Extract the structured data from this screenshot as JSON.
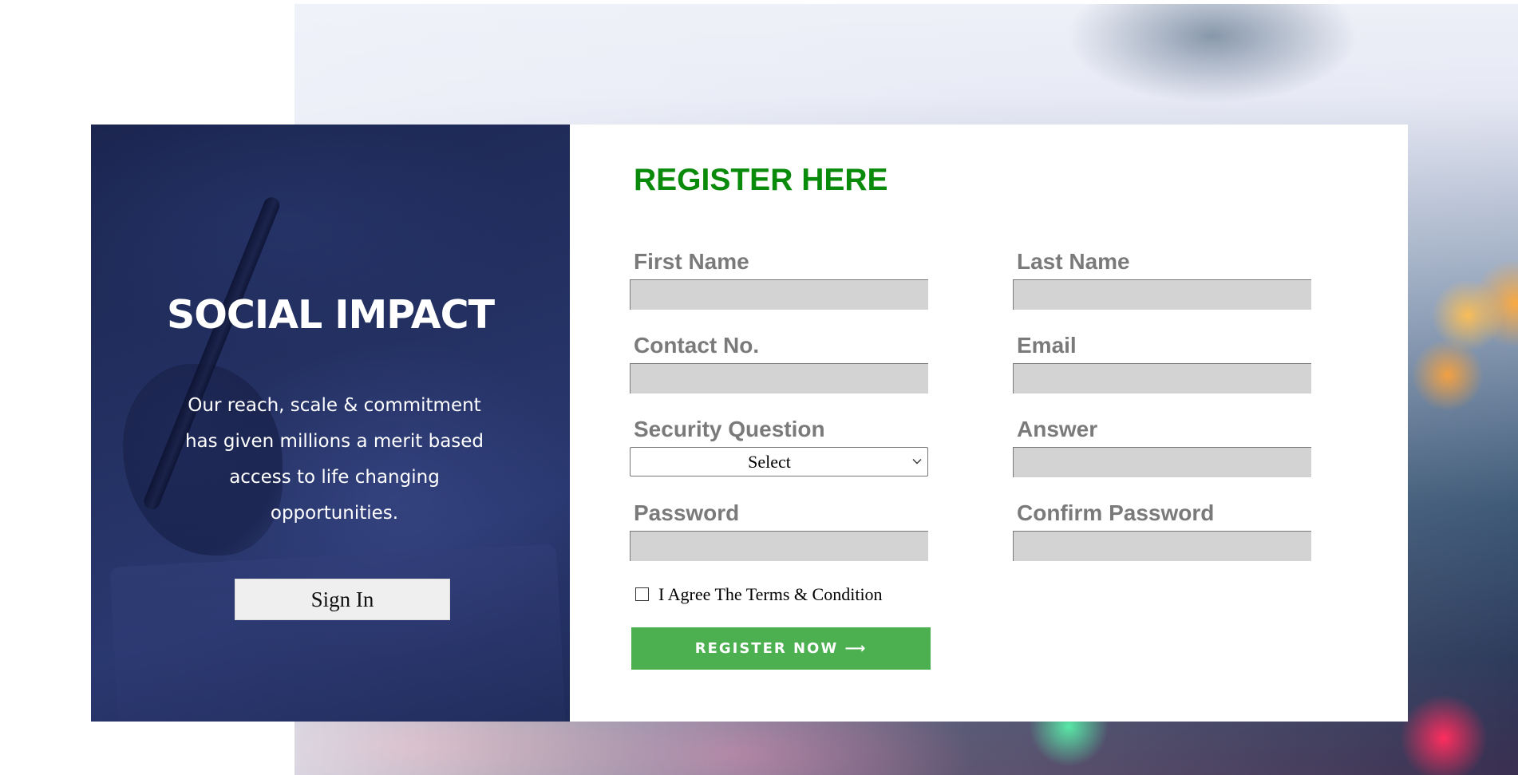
{
  "left_panel": {
    "title": "SOCIAL IMPACT",
    "text": "Our reach, scale & commitment has given millions a merit based access to life changing opportunities.",
    "signin_label": "Sign In"
  },
  "form": {
    "title": "REGISTER HERE",
    "fields": {
      "first_name": {
        "label": "First Name",
        "value": ""
      },
      "last_name": {
        "label": "Last Name",
        "value": ""
      },
      "contact": {
        "label": "Contact No.",
        "value": ""
      },
      "email": {
        "label": "Email",
        "value": ""
      },
      "security_question": {
        "label": "Security Question",
        "selected": "Select"
      },
      "answer": {
        "label": "Answer",
        "value": ""
      },
      "password": {
        "label": "Password",
        "value": ""
      },
      "confirm_password": {
        "label": "Confirm Password",
        "value": ""
      }
    },
    "terms_label": "I Agree The Terms & Condition",
    "terms_checked": false,
    "register_label": "REGISTER NOW ⟶"
  },
  "colors": {
    "title_green": "#0a8a0a",
    "button_green": "#4caf50",
    "label_gray": "#7a7a7a",
    "input_gray": "#d3d3d3",
    "panel_navy": "#243163"
  }
}
